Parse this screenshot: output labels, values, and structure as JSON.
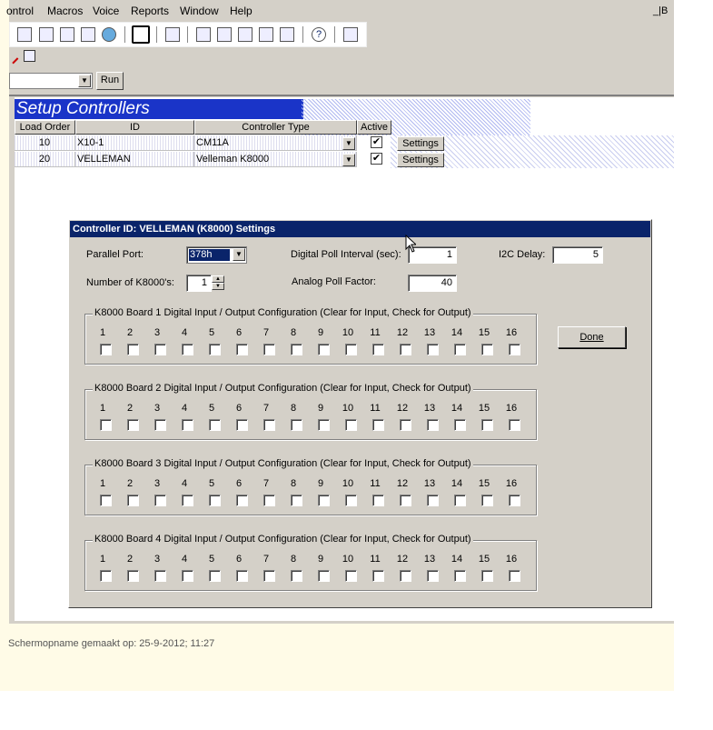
{
  "menu": {
    "items": [
      "ontrol",
      "Macros",
      "Voice",
      "Reports",
      "Window",
      "Help"
    ],
    "mdi_button": "_|B"
  },
  "toolbar": {
    "icons": [
      "controller-icon",
      "camera-icon",
      "network-icon",
      "monitor-icon",
      "globe-icon",
      "clock-icon",
      "list-icon",
      "grid-icon",
      "form-icon",
      "window-icon",
      "report-icon",
      "tree-icon",
      "help-icon",
      "tools-icon"
    ]
  },
  "toolbar2": {
    "icons": [
      "pencil-icon",
      "exit-icon"
    ]
  },
  "runbar": {
    "combo_value": "",
    "run_label": "Run"
  },
  "setup": {
    "title": "Setup Controllers",
    "columns": [
      "Load Order",
      "ID",
      "Controller Type",
      "Active"
    ],
    "rows": [
      {
        "load_order": "10",
        "id": "X10-1",
        "type": "CM11A",
        "active": true,
        "settings": "Settings"
      },
      {
        "load_order": "20",
        "id": "VELLEMAN",
        "type": "Velleman K8000",
        "active": true,
        "settings": "Settings"
      }
    ]
  },
  "dialog": {
    "title": "Controller ID: VELLEMAN (K8000) Settings",
    "parallel_port_label": "Parallel Port:",
    "parallel_port_value": "378h",
    "digital_poll_label": "Digital Poll Interval (sec):",
    "digital_poll_value": "1",
    "i2c_delay_label": "I2C Delay:",
    "i2c_delay_value": "5",
    "num_k8000_label": "Number of K8000's:",
    "num_k8000_value": "1",
    "analog_poll_label": "Analog Poll Factor:",
    "analog_poll_value": "40",
    "done_label": "Done",
    "boards": [
      {
        "title": "K8000 Board 1 Digital Input / Output Configuration (Clear for Input, Check for Output)"
      },
      {
        "title": "K8000 Board 2 Digital Input / Output Configuration (Clear for Input, Check for Output)"
      },
      {
        "title": "K8000 Board 3 Digital Input / Output Configuration (Clear for Input, Check for Output)"
      },
      {
        "title": "K8000 Board 4 Digital Input / Output Configuration (Clear for Input, Check for Output)"
      }
    ],
    "channels": [
      "1",
      "2",
      "3",
      "4",
      "5",
      "6",
      "7",
      "8",
      "9",
      "10",
      "11",
      "12",
      "13",
      "14",
      "15",
      "16"
    ]
  },
  "caption": "Schermopname gemaakt op: 25-9-2012; 11:27"
}
